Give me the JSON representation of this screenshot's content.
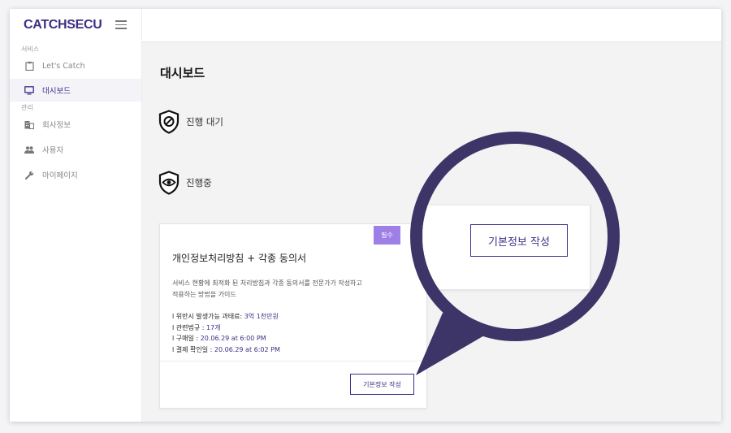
{
  "brand": {
    "logo_text": "CATCHSECU",
    "accent": "#3c2f86",
    "badge_color": "#9d7fe6"
  },
  "sidebar": {
    "section_service": "서비스",
    "section_manage": "관리",
    "items": [
      {
        "label": "Let's Catch",
        "icon": "clipboard-icon"
      },
      {
        "label": "대시보드",
        "icon": "monitor-icon",
        "active": true
      },
      {
        "label": "회사정보",
        "icon": "building-icon"
      },
      {
        "label": "사용자",
        "icon": "people-icon"
      },
      {
        "label": "마이페이지",
        "icon": "wrench-icon"
      }
    ]
  },
  "main": {
    "title": "대시보드",
    "status": [
      {
        "label": "진행 대기",
        "icon": "shield-block-icon"
      },
      {
        "label": "진행중",
        "icon": "shield-eye-icon"
      }
    ]
  },
  "card": {
    "badge": "필수",
    "title": "개인정보처리방침 + 각종 동의서",
    "desc_line1": "서비스 현황에 최적화 된 처리방침과 각종 동의서를 전문가가 작성하고",
    "desc_line2": "적용하는 방법을 가이드",
    "details": [
      {
        "label": "l 위반시 발생가능 과태료: ",
        "value": "3억 1천만원"
      },
      {
        "label": "l 관련법규 : ",
        "value": "17개"
      },
      {
        "label": "l 구매일 : ",
        "value": "20.06.29 at 6:00 PM"
      },
      {
        "label": "l 결제 확인일 : ",
        "value": "20.06.29 at 6:02 PM"
      }
    ],
    "button_label": "기본정보 작성"
  },
  "magnifier": {
    "button_label": "기본정보 작성"
  }
}
